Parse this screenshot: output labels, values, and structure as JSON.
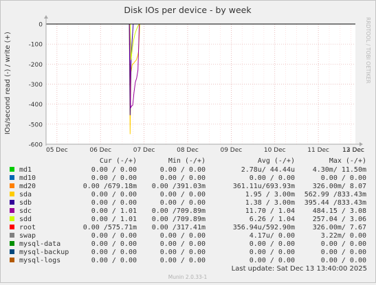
{
  "chart_data": {
    "type": "line",
    "title": "Disk IOs per device - by week",
    "ylabel": "IOs/second read (-) / write (+)",
    "side_label": "RRDTOOL / TOBI OETIKER",
    "footer": "Munin 2.0.33-1",
    "last_update": "Last update:  Sat Dec 13 13:40:00 2025",
    "ylim": [
      -600,
      0
    ],
    "yticks": [
      0,
      -100,
      -200,
      -300,
      -400,
      -500,
      -600
    ],
    "xlim": [
      0,
      7.1
    ],
    "xticks": [
      {
        "label": "05 Dec",
        "x": 0.25
      },
      {
        "label": "06 Dec",
        "x": 1.25
      },
      {
        "label": "07 Dec",
        "x": 2.25
      },
      {
        "label": "08 Dec",
        "x": 3.25
      },
      {
        "label": "09 Dec",
        "x": 4.25
      },
      {
        "label": "10 Dec",
        "x": 5.25
      },
      {
        "label": "11 Dec",
        "x": 6.25
      },
      {
        "label": "12 Dec",
        "x": 7.25
      },
      {
        "label": "13 Dec",
        "x": 8.25
      }
    ],
    "columns": [
      "Cur (-/+)",
      "Min (-/+)",
      "Avg (-/+)",
      "Max (-/+)"
    ],
    "series": [
      {
        "name": "md1",
        "color": "#00cc00",
        "cur": "0.00 /  0.00",
        "min": "0.00 /  0.00",
        "avg": "2.78u/ 44.44u",
        "max": "4.30m/ 11.50m"
      },
      {
        "name": "md10",
        "color": "#0066b3",
        "cur": "0.00 /  0.00",
        "min": "0.00 /  0.00",
        "avg": "0.00 /  0.00",
        "max": "0.00 /  0.00"
      },
      {
        "name": "md20",
        "color": "#ff8000",
        "cur": "0.00 /679.18m",
        "min": "0.00 /391.03m",
        "avg": "361.11u/693.93m",
        "max": "326.00m/  8.07"
      },
      {
        "name": "sda",
        "color": "#ffcc00",
        "cur": "0.00 /  0.00",
        "min": "0.00 /  0.00",
        "avg": "1.95 /  3.00m",
        "max": "562.99 /833.43m"
      },
      {
        "name": "sdb",
        "color": "#330099",
        "cur": "0.00 /  0.00",
        "min": "0.00 /  0.00",
        "avg": "1.38 /  3.00m",
        "max": "395.44 /833.43m"
      },
      {
        "name": "sdc",
        "color": "#990099",
        "cur": "0.00 /  1.01",
        "min": "0.00 /709.89m",
        "avg": "11.70 /  1.04",
        "max": "484.15 /  3.08"
      },
      {
        "name": "sdd",
        "color": "#ccff00",
        "cur": "0.00 /  1.01",
        "min": "0.00 /709.89m",
        "avg": "6.26 /  1.04",
        "max": "257.04 /  3.06"
      },
      {
        "name": "root",
        "color": "#ff0000",
        "cur": "0.00 /575.71m",
        "min": "0.00 /317.41m",
        "avg": "356.94u/592.90m",
        "max": "326.00m/  7.67"
      },
      {
        "name": "swap",
        "color": "#808080",
        "cur": "0.00 /  0.00",
        "min": "0.00 /  0.00",
        "avg": "4.17u/  0.00",
        "max": "3.22m/  0.00"
      },
      {
        "name": "mysql-data",
        "color": "#008f00",
        "cur": "0.00 /  0.00",
        "min": "0.00 /  0.00",
        "avg": "0.00 /  0.00",
        "max": "0.00 /  0.00"
      },
      {
        "name": "mysql-backup",
        "color": "#00487d",
        "cur": "0.00 /  0.00",
        "min": "0.00 /  0.00",
        "avg": "0.00 /  0.00",
        "max": "0.00 /  0.00"
      },
      {
        "name": "mysql-logs",
        "color": "#b35a00",
        "cur": "0.00 /  0.00",
        "min": "0.00 /  0.00",
        "avg": "0.00 /  0.00",
        "max": "0.00 /  0.00"
      }
    ],
    "lines": [
      {
        "name": "sda",
        "color": "#ffcc00",
        "points": [
          [
            1.91,
            0
          ],
          [
            1.93,
            -550
          ],
          [
            1.95,
            -240
          ],
          [
            1.98,
            -200
          ],
          [
            2.0,
            -200
          ],
          [
            2.03,
            -190
          ],
          [
            2.07,
            -180
          ],
          [
            2.1,
            -160
          ],
          [
            2.12,
            -140
          ],
          [
            2.14,
            -60
          ],
          [
            2.15,
            0
          ]
        ]
      },
      {
        "name": "sdb",
        "color": "#330099",
        "points": [
          [
            1.91,
            0
          ],
          [
            1.93,
            -455
          ],
          [
            1.95,
            -200
          ],
          [
            1.97,
            -100
          ],
          [
            2.0,
            0
          ]
        ]
      },
      {
        "name": "sdc",
        "color": "#990099",
        "points": [
          [
            1.92,
            0
          ],
          [
            1.94,
            -420
          ],
          [
            1.96,
            -410
          ],
          [
            1.99,
            -405
          ],
          [
            2.02,
            -340
          ],
          [
            2.05,
            -290
          ],
          [
            2.08,
            -270
          ],
          [
            2.11,
            -230
          ],
          [
            2.13,
            -80
          ],
          [
            2.14,
            0
          ]
        ]
      },
      {
        "name": "sdd",
        "color": "#ccff00",
        "points": [
          [
            1.93,
            0
          ],
          [
            1.95,
            -180
          ],
          [
            1.98,
            -120
          ],
          [
            2.01,
            -80
          ],
          [
            2.04,
            -50
          ],
          [
            2.07,
            -30
          ],
          [
            2.11,
            -10
          ],
          [
            2.14,
            0
          ]
        ]
      }
    ]
  }
}
